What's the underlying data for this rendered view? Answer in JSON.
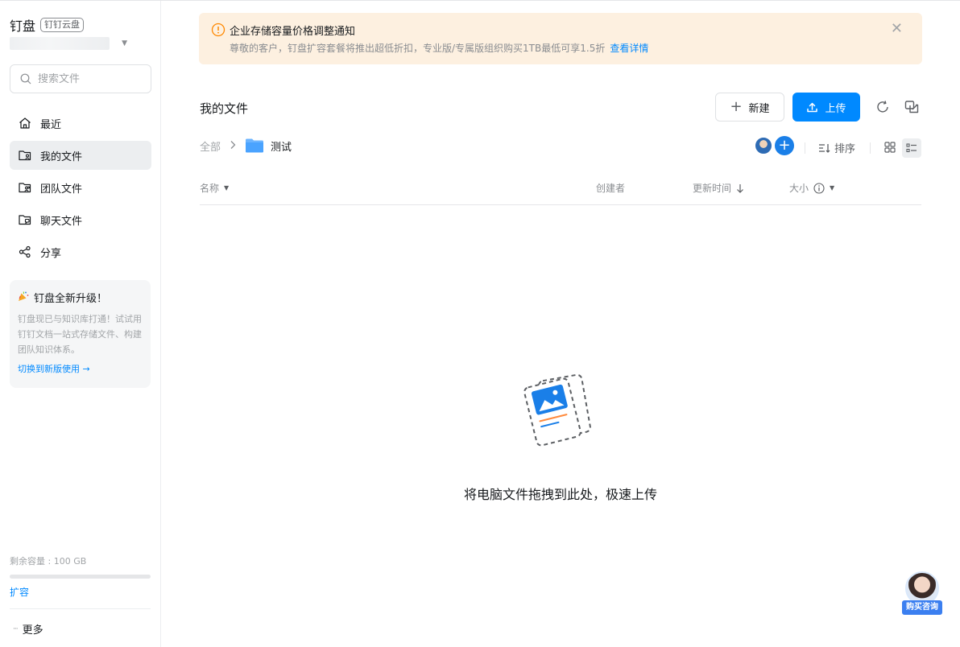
{
  "sidebar": {
    "brand_title": "钉盘",
    "brand_tag": "钉钉云盘",
    "search_placeholder": "搜索文件",
    "items": [
      {
        "label": "最近",
        "icon": "home-icon"
      },
      {
        "label": "我的文件",
        "icon": "my-files-folder-icon"
      },
      {
        "label": "团队文件",
        "icon": "team-folder-icon"
      },
      {
        "label": "聊天文件",
        "icon": "chat-folder-icon"
      },
      {
        "label": "分享",
        "icon": "share-icon"
      }
    ],
    "active_item": "我的文件",
    "promo": {
      "title": "钉盘全新升级！",
      "text": "钉盘现已与知识库打通！试试用钉钉文档一站式存储文件、构建团队知识体系。",
      "link": "切换到新版使用 →"
    },
    "storage_label": "剩余容量 : 100 GB",
    "expand_label": "扩容",
    "more_label": "更多"
  },
  "notice": {
    "title": "企业存储容量价格调整通知",
    "body": "尊敬的客户，钉盘扩容套餐将推出超低折扣，专业版/专属版组织购买1TB最低可享1.5折",
    "link": "查看详情"
  },
  "main": {
    "title": "我的文件",
    "new_label": "新建",
    "upload_label": "上传",
    "breadcrumb_root": "全部",
    "breadcrumb_folder": "测试",
    "sort_label": "排序",
    "columns": {
      "name": "名称",
      "creator": "创建者",
      "updated": "更新时间",
      "size": "大小"
    },
    "empty_text": "将电脑文件拖拽到此处，极速上传"
  },
  "consult_label": "购买咨询",
  "colors": {
    "accent": "#0089ff",
    "notice_bg": "#fdf0e0",
    "notice_icon": "#ff8800"
  }
}
